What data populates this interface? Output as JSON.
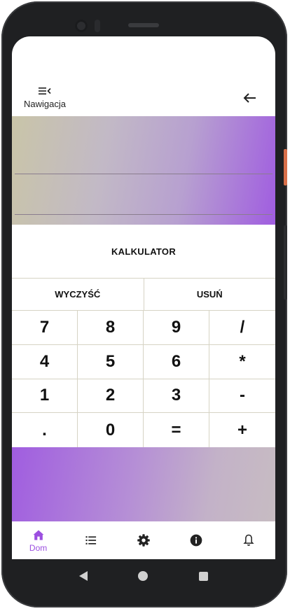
{
  "appbar": {
    "nav_label": "Nawigacja",
    "nav_icon": "menu-collapse-icon",
    "back_icon": "arrow-left-icon"
  },
  "calculator": {
    "title": "KALKULATOR",
    "clear_label": "WYCZYŚĆ",
    "delete_label": "USUŃ",
    "keys": [
      "7",
      "8",
      "9",
      "/",
      "4",
      "5",
      "6",
      "*",
      "1",
      "2",
      "3",
      "-",
      ".",
      "0",
      "=",
      "+"
    ]
  },
  "bottom_nav": {
    "items": [
      {
        "icon": "home-icon",
        "label": "Dom",
        "active": true
      },
      {
        "icon": "list-icon",
        "label": ""
      },
      {
        "icon": "gear-icon",
        "label": ""
      },
      {
        "icon": "info-icon",
        "label": ""
      },
      {
        "icon": "bell-icon",
        "label": ""
      }
    ]
  },
  "colors": {
    "accent": "#9c4fe0",
    "gradient_start": "#c9c5a8",
    "gradient_end": "#a05de0"
  }
}
